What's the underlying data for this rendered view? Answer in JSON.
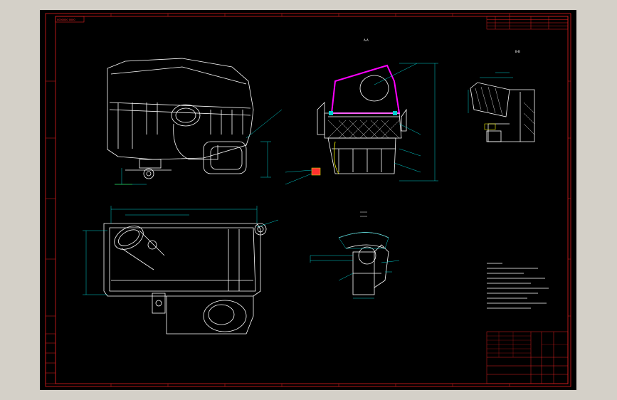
{
  "drawing": {
    "corner_stamp": "0000000 0000",
    "section_labels": {
      "aa": "A-A",
      "bb": "B-B"
    },
    "colors": {
      "frame": "#e02020",
      "lines": "#ffffff",
      "dims": "#00d0d0",
      "hatch": "#ff00ff",
      "background": "#000000"
    }
  }
}
